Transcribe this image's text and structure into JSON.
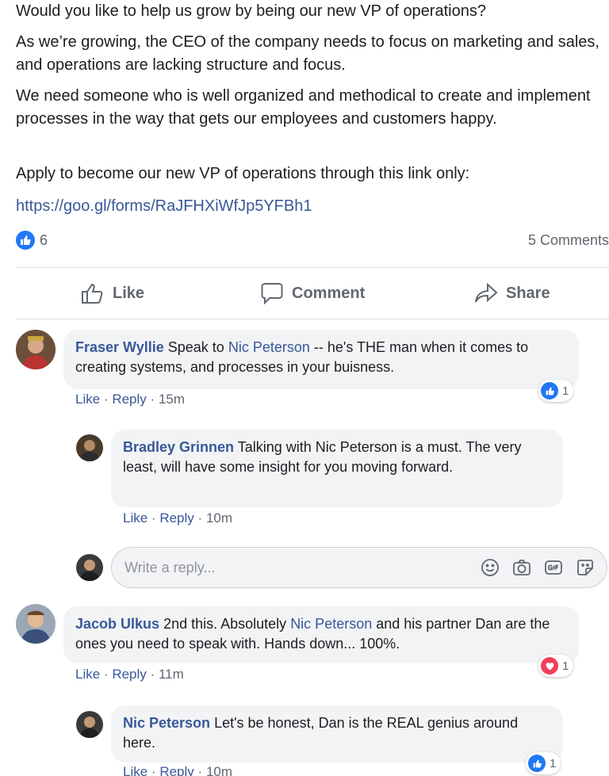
{
  "post": {
    "p1": "Would you like to help us grow by being our new VP of operations?",
    "p2": "As we’re growing, the CEO of the company needs to focus on marketing and sales, and operations are lacking structure and focus.",
    "p3": "We need someone who is well organized and methodical to create and implement processes in the way that gets our employees and customers happy.",
    "p4": "Apply to become our new VP of operations through this link only:",
    "link": "https://goo.gl/forms/RaJFHXiWfJp5YFBh1",
    "reaction_count": "6",
    "comments_count": "5 Comments"
  },
  "actions": {
    "like": "Like",
    "comment": "Comment",
    "share": "Share"
  },
  "comments": [
    {
      "author": "Fraser Wyllie",
      "before": "Speak to",
      "mention": "Nic Peterson",
      "after": "-- he's THE man when it comes to creating systems, and processes in your buisness.",
      "like": "Like",
      "reply": "Reply",
      "time": "15m",
      "reactions": "1"
    },
    {
      "author": "Bradley Grinnen",
      "text": "Talking with Nic Peterson is a must. The very least, will have some insight for you moving forward.",
      "like": "Like",
      "reply": "Reply",
      "time": "10m"
    },
    {
      "author": "Jacob Ulkus",
      "before": "2nd this. Absolutely",
      "mention": "Nic Peterson",
      "after": "and his partner Dan are the ones you need to speak with. Hands down... 100%.",
      "like": "Like",
      "reply": "Reply",
      "time": "11m",
      "reactions": "1"
    },
    {
      "author": "Nic Peterson",
      "text": "Let's be honest, Dan is the REAL genius around here.",
      "like": "Like",
      "reply": "Reply",
      "time": "10m",
      "reactions": "1"
    }
  ],
  "reply_box": {
    "placeholder": "Write a reply...",
    "separator": "·"
  },
  "colors": {
    "brand_blue": "#2078f4",
    "link": "#385898",
    "love": "#f33e58"
  }
}
